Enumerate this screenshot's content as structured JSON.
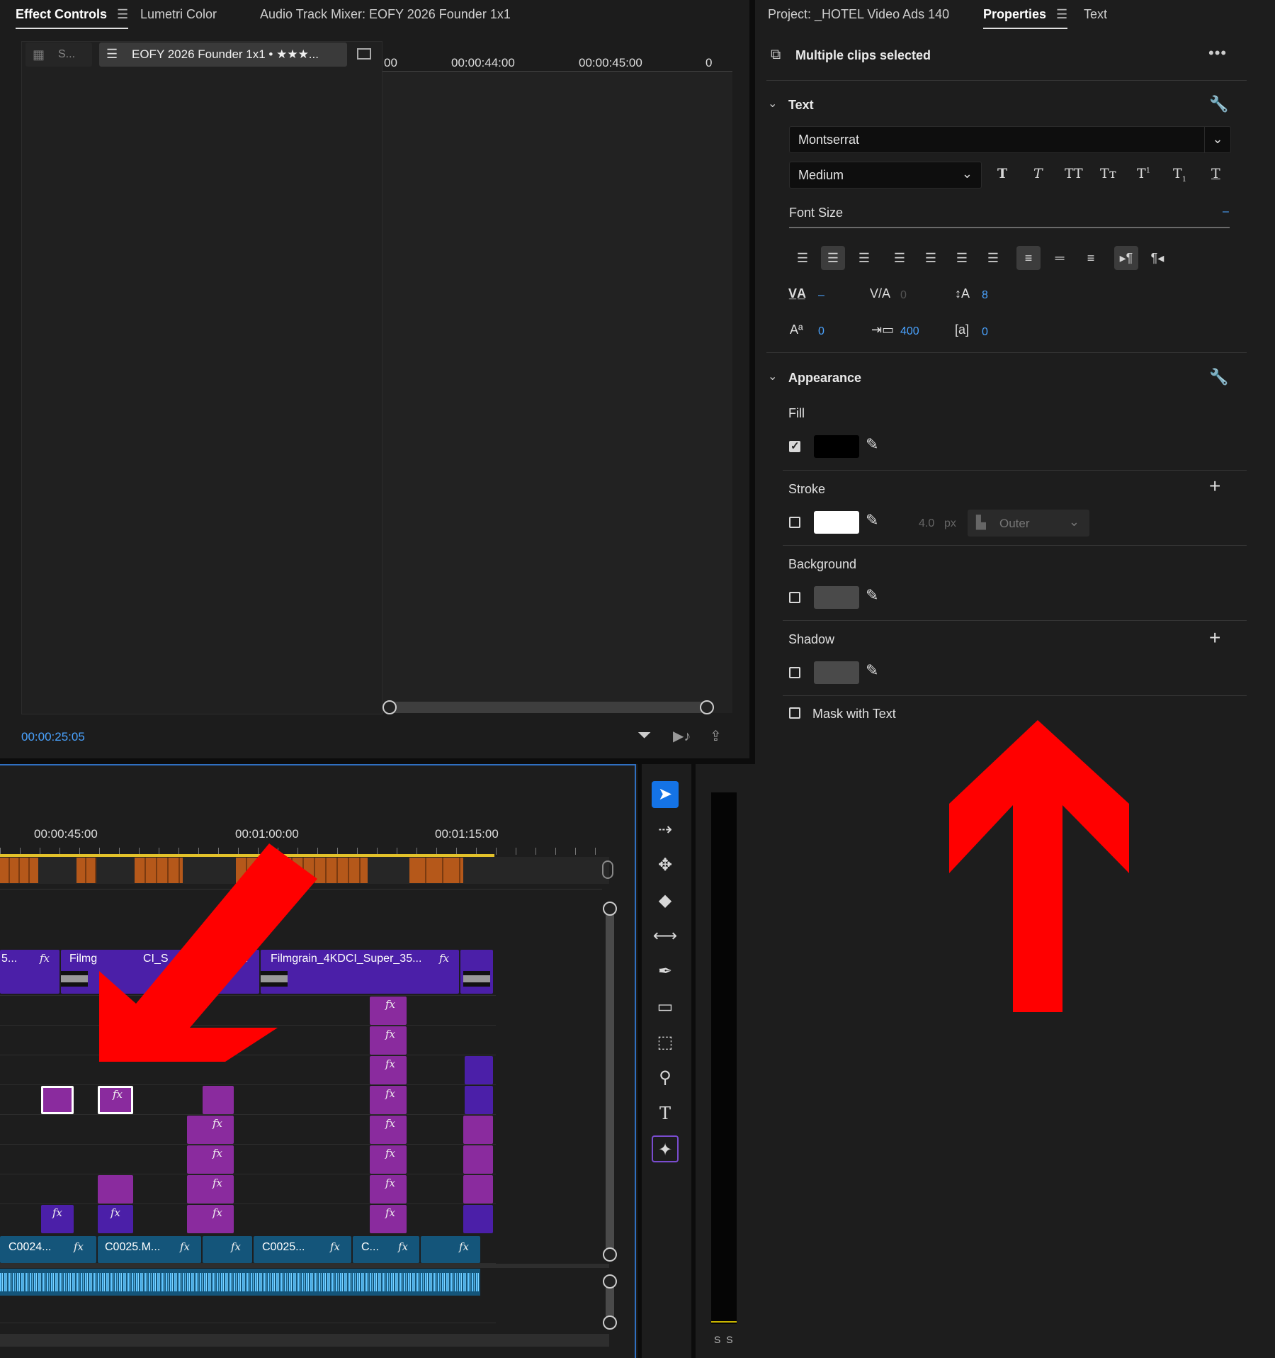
{
  "effect_panel": {
    "tabs": [
      "Effect Controls",
      "Lumetri Color",
      "Audio Track Mixer: EOFY 2026 Founder 1x1"
    ],
    "source_chip": "S...",
    "sequence_chip": "EOFY 2026 Founder 1x1 • ★★★...",
    "ruler_labels": [
      "00",
      "00:00:44:00",
      "00:00:45:00",
      "0"
    ],
    "timecode": "00:00:25:05"
  },
  "right_panel": {
    "tabs": [
      "Project: _HOTEL Video Ads 140",
      "Properties",
      "Text"
    ],
    "header": "Multiple clips selected",
    "text_section": {
      "title": "Text",
      "font": "Montserrat",
      "weight": "Medium",
      "font_size_label": "Font Size",
      "font_size_value": "–",
      "kerning": "–",
      "tracking_small": "0",
      "leading": "8",
      "baseline": "0",
      "tracking": "400",
      "tsume": "0"
    },
    "appearance": {
      "title": "Appearance",
      "fill": "Fill",
      "stroke": "Stroke",
      "stroke_width": "4.0",
      "stroke_unit": "px",
      "stroke_type": "Outer",
      "background": "Background",
      "shadow": "Shadow",
      "mask": "Mask with Text"
    },
    "colors": {
      "fill": "#000000",
      "stroke": "#ffffff",
      "background": "#4a4a4a",
      "shadow": "#4a4a4a",
      "arrow": "#ff0000"
    }
  },
  "timeline": {
    "ruler_labels": [
      "00:00:45:00",
      "00:01:00:00",
      "00:01:15:00"
    ],
    "clips_v": [
      "5...",
      "Filmg",
      "CI_S",
      "Filmgrain_4KDCI_Super_35..."
    ],
    "clips_a": [
      "C0024...",
      "C0025.M...",
      "C0025...",
      "C..."
    ],
    "fx": "fx"
  },
  "meter": {
    "label": "S S"
  }
}
